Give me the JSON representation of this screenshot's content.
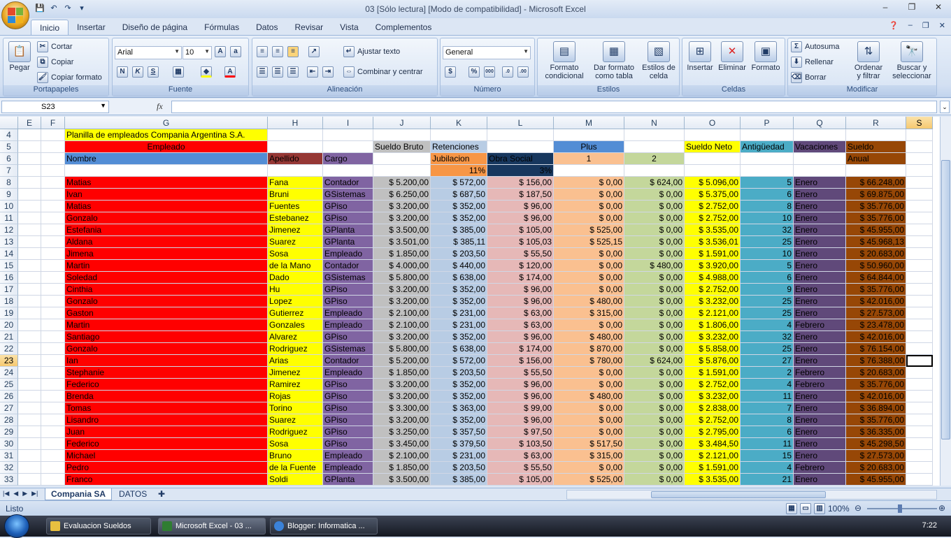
{
  "window": {
    "title": "03  [Sólo lectura]  [Modo de compatibilidad] - Microsoft Excel",
    "min": "–",
    "max": "❐",
    "close": "✕"
  },
  "ribbon_tabs": [
    "Inicio",
    "Insertar",
    "Diseño de página",
    "Fórmulas",
    "Datos",
    "Revisar",
    "Vista",
    "Complementos"
  ],
  "groups": {
    "portapapeles": {
      "label": "Portapapeles",
      "pegar": "Pegar",
      "cortar": "Cortar",
      "copiar": "Copiar",
      "copiar_formato": "Copiar formato"
    },
    "fuente": {
      "label": "Fuente",
      "font": "Arial",
      "size": "10"
    },
    "alineacion": {
      "label": "Alineación",
      "ajustar": "Ajustar texto",
      "combinar": "Combinar y centrar"
    },
    "numero": {
      "label": "Número",
      "format": "General"
    },
    "estilos": {
      "label": "Estilos",
      "formato_cond_1": "Formato",
      "formato_cond_2": "condicional",
      "dar_formato_1": "Dar formato",
      "dar_formato_2": "como tabla",
      "estilos_celda_1": "Estilos de",
      "estilos_celda_2": "celda"
    },
    "celdas": {
      "label": "Celdas",
      "insertar": "Insertar",
      "eliminar": "Eliminar",
      "formato": "Formato"
    },
    "modificar": {
      "label": "Modificar",
      "autosuma": "Autosuma",
      "rellenar": "Rellenar",
      "borrar": "Borrar",
      "ordenar_1": "Ordenar",
      "ordenar_2": "y filtrar",
      "buscar_1": "Buscar y",
      "buscar_2": "seleccionar"
    }
  },
  "namebox": "S23",
  "fx": "fx",
  "columns": [
    "E",
    "F",
    "G",
    "H",
    "I",
    "J",
    "K",
    "L",
    "M",
    "N",
    "O",
    "P",
    "Q",
    "R",
    "S"
  ],
  "header_rows": {
    "r4": {
      "num": "4",
      "title": "Planilla de empleados Compania Argentina S.A."
    },
    "r5": {
      "num": "5",
      "empleado": "Empleado",
      "sueldo_bruto": "Sueldo Bruto",
      "retenciones": "Retenciones",
      "plus": "Plus",
      "sueldo_neto": "Sueldo Neto",
      "antiguedad": "Antigüedad",
      "vacaciones": "Vacaciones",
      "sueldo_anual_1": "Sueldo"
    },
    "r6": {
      "num": "6",
      "nombre": "Nombre",
      "apellido": "Apellido",
      "cargo": "Cargo",
      "jubilacion": "Jubilacion",
      "obra_social": "Obra Social",
      "plus1": "1",
      "plus2": "2",
      "sueldo_anual_2": "Anual"
    },
    "r7": {
      "num": "7",
      "jub_pct": "11%",
      "os_pct": "3%"
    }
  },
  "rows": [
    [
      "8",
      "Matias",
      "Fana",
      "Contador",
      "$ 5.200,00",
      "$ 572,00",
      "$ 156,00",
      "$ 0,00",
      "$ 624,00",
      "$ 5.096,00",
      "5",
      "Enero",
      "$ 66.248,00"
    ],
    [
      "9",
      "Ivan",
      "Bruni",
      "GSistemas",
      "$ 6.250,00",
      "$ 687,50",
      "$ 187,50",
      "$ 0,00",
      "$ 0,00",
      "$ 5.375,00",
      "6",
      "Enero",
      "$ 69.875,00"
    ],
    [
      "10",
      "Matias",
      "Fuentes",
      "GPiso",
      "$ 3.200,00",
      "$ 352,00",
      "$ 96,00",
      "$ 0,00",
      "$ 0,00",
      "$ 2.752,00",
      "8",
      "Enero",
      "$ 35.776,00"
    ],
    [
      "11",
      "Gonzalo",
      "Estebanez",
      "GPiso",
      "$ 3.200,00",
      "$ 352,00",
      "$ 96,00",
      "$ 0,00",
      "$ 0,00",
      "$ 2.752,00",
      "10",
      "Enero",
      "$ 35.776,00"
    ],
    [
      "12",
      "Estefania",
      "Jimenez",
      "GPlanta",
      "$ 3.500,00",
      "$ 385,00",
      "$ 105,00",
      "$ 525,00",
      "$ 0,00",
      "$ 3.535,00",
      "32",
      "Enero",
      "$ 45.955,00"
    ],
    [
      "13",
      "Aldana",
      "Suarez",
      "GPlanta",
      "$ 3.501,00",
      "$ 385,11",
      "$ 105,03",
      "$ 525,15",
      "$ 0,00",
      "$ 3.536,01",
      "25",
      "Enero",
      "$ 45.968,13"
    ],
    [
      "14",
      "Jimena",
      "Sosa",
      "Empleado",
      "$ 1.850,00",
      "$ 203,50",
      "$ 55,50",
      "$ 0,00",
      "$ 0,00",
      "$ 1.591,00",
      "10",
      "Enero",
      "$ 20.683,00"
    ],
    [
      "15",
      "Martin",
      "de la Mano",
      "Contador",
      "$ 4.000,00",
      "$ 440,00",
      "$ 120,00",
      "$ 0,00",
      "$ 480,00",
      "$ 3.920,00",
      "5",
      "Enero",
      "$ 50.960,00"
    ],
    [
      "16",
      "Soledad",
      "Dado",
      "GSistemas",
      "$ 5.800,00",
      "$ 638,00",
      "$ 174,00",
      "$ 0,00",
      "$ 0,00",
      "$ 4.988,00",
      "6",
      "Enero",
      "$ 64.844,00"
    ],
    [
      "17",
      "Cinthia",
      "Hu",
      "GPiso",
      "$ 3.200,00",
      "$ 352,00",
      "$ 96,00",
      "$ 0,00",
      "$ 0,00",
      "$ 2.752,00",
      "9",
      "Enero",
      "$ 35.776,00"
    ],
    [
      "18",
      "Gonzalo",
      "Lopez",
      "GPiso",
      "$ 3.200,00",
      "$ 352,00",
      "$ 96,00",
      "$ 480,00",
      "$ 0,00",
      "$ 3.232,00",
      "25",
      "Enero",
      "$ 42.016,00"
    ],
    [
      "19",
      "Gaston",
      "Gutierrez",
      "Empleado",
      "$ 2.100,00",
      "$ 231,00",
      "$ 63,00",
      "$ 315,00",
      "$ 0,00",
      "$ 2.121,00",
      "25",
      "Enero",
      "$ 27.573,00"
    ],
    [
      "20",
      "Martin",
      "Gonzales",
      "Empleado",
      "$ 2.100,00",
      "$ 231,00",
      "$ 63,00",
      "$ 0,00",
      "$ 0,00",
      "$ 1.806,00",
      "4",
      "Febrero",
      "$ 23.478,00"
    ],
    [
      "21",
      "Santiago",
      "Alvarez",
      "GPiso",
      "$ 3.200,00",
      "$ 352,00",
      "$ 96,00",
      "$ 480,00",
      "$ 0,00",
      "$ 3.232,00",
      "32",
      "Enero",
      "$ 42.016,00"
    ],
    [
      "22",
      "Gonzalo",
      "Rodriguez",
      "GSistemas",
      "$ 5.800,00",
      "$ 638,00",
      "$ 174,00",
      "$ 870,00",
      "$ 0,00",
      "$ 5.858,00",
      "25",
      "Enero",
      "$ 76.154,00"
    ],
    [
      "23",
      "Ian",
      "Arias",
      "Contador",
      "$ 5.200,00",
      "$ 572,00",
      "$ 156,00",
      "$ 780,00",
      "$ 624,00",
      "$ 5.876,00",
      "27",
      "Enero",
      "$ 76.388,00"
    ],
    [
      "24",
      "Stephanie",
      "Jimenez",
      "Empleado",
      "$ 1.850,00",
      "$ 203,50",
      "$ 55,50",
      "$ 0,00",
      "$ 0,00",
      "$ 1.591,00",
      "2",
      "Febrero",
      "$ 20.683,00"
    ],
    [
      "25",
      "Federico",
      "Ramirez",
      "GPiso",
      "$ 3.200,00",
      "$ 352,00",
      "$ 96,00",
      "$ 0,00",
      "$ 0,00",
      "$ 2.752,00",
      "4",
      "Febrero",
      "$ 35.776,00"
    ],
    [
      "26",
      "Brenda",
      "Rojas",
      "GPiso",
      "$ 3.200,00",
      "$ 352,00",
      "$ 96,00",
      "$ 480,00",
      "$ 0,00",
      "$ 3.232,00",
      "11",
      "Enero",
      "$ 42.016,00"
    ],
    [
      "27",
      "Tomas",
      "Torino",
      "GPiso",
      "$ 3.300,00",
      "$ 363,00",
      "$ 99,00",
      "$ 0,00",
      "$ 0,00",
      "$ 2.838,00",
      "7",
      "Enero",
      "$ 36.894,00"
    ],
    [
      "28",
      "Lisandro",
      "Suarez",
      "GPiso",
      "$ 3.200,00",
      "$ 352,00",
      "$ 96,00",
      "$ 0,00",
      "$ 0,00",
      "$ 2.752,00",
      "8",
      "Enero",
      "$ 35.776,00"
    ],
    [
      "29",
      "Juan",
      "Rodriguez",
      "GPiso",
      "$ 3.250,00",
      "$ 357,50",
      "$ 97,50",
      "$ 0,00",
      "$ 0,00",
      "$ 2.795,00",
      "6",
      "Enero",
      "$ 36.335,00"
    ],
    [
      "30",
      "Federico",
      "Sosa",
      "GPiso",
      "$ 3.450,00",
      "$ 379,50",
      "$ 103,50",
      "$ 517,50",
      "$ 0,00",
      "$ 3.484,50",
      "11",
      "Enero",
      "$ 45.298,50"
    ],
    [
      "31",
      "Michael",
      "Bruno",
      "Empleado",
      "$ 2.100,00",
      "$ 231,00",
      "$ 63,00",
      "$ 315,00",
      "$ 0,00",
      "$ 2.121,00",
      "15",
      "Enero",
      "$ 27.573,00"
    ],
    [
      "32",
      "Pedro",
      "de la Fuente",
      "Empleado",
      "$ 1.850,00",
      "$ 203,50",
      "$ 55,50",
      "$ 0,00",
      "$ 0,00",
      "$ 1.591,00",
      "4",
      "Febrero",
      "$ 20.683,00"
    ],
    [
      "33",
      "Franco",
      "Soldi",
      "GPlanta",
      "$ 3.500,00",
      "$ 385,00",
      "$ 105,00",
      "$ 525,00",
      "$ 0,00",
      "$ 3.535,00",
      "21",
      "Enero",
      "$ 45.955,00"
    ]
  ],
  "sheet_tabs": [
    "Compania SA",
    "DATOS"
  ],
  "status": {
    "text": "Listo",
    "zoom": "100%"
  },
  "taskbar": {
    "items": [
      "Evaluacion Sueldos",
      "Microsoft Excel - 03 ...",
      "Blogger: Informatica ..."
    ],
    "clock": "7:22"
  },
  "colors": {
    "red": "#ff0000",
    "yellow": "#ffff00",
    "purple": "#8064a2",
    "gray": "#c0c0c0",
    "lightblue": "#b8cce4",
    "pink": "#e6b8b7",
    "peach": "#fac090",
    "green": "#c4d79b",
    "teal": "#4bacc6",
    "darkpurple": "#60497a",
    "brown": "#974706",
    "blue": "#538dd5",
    "navy": "#17375e",
    "orange": "#f79646"
  }
}
